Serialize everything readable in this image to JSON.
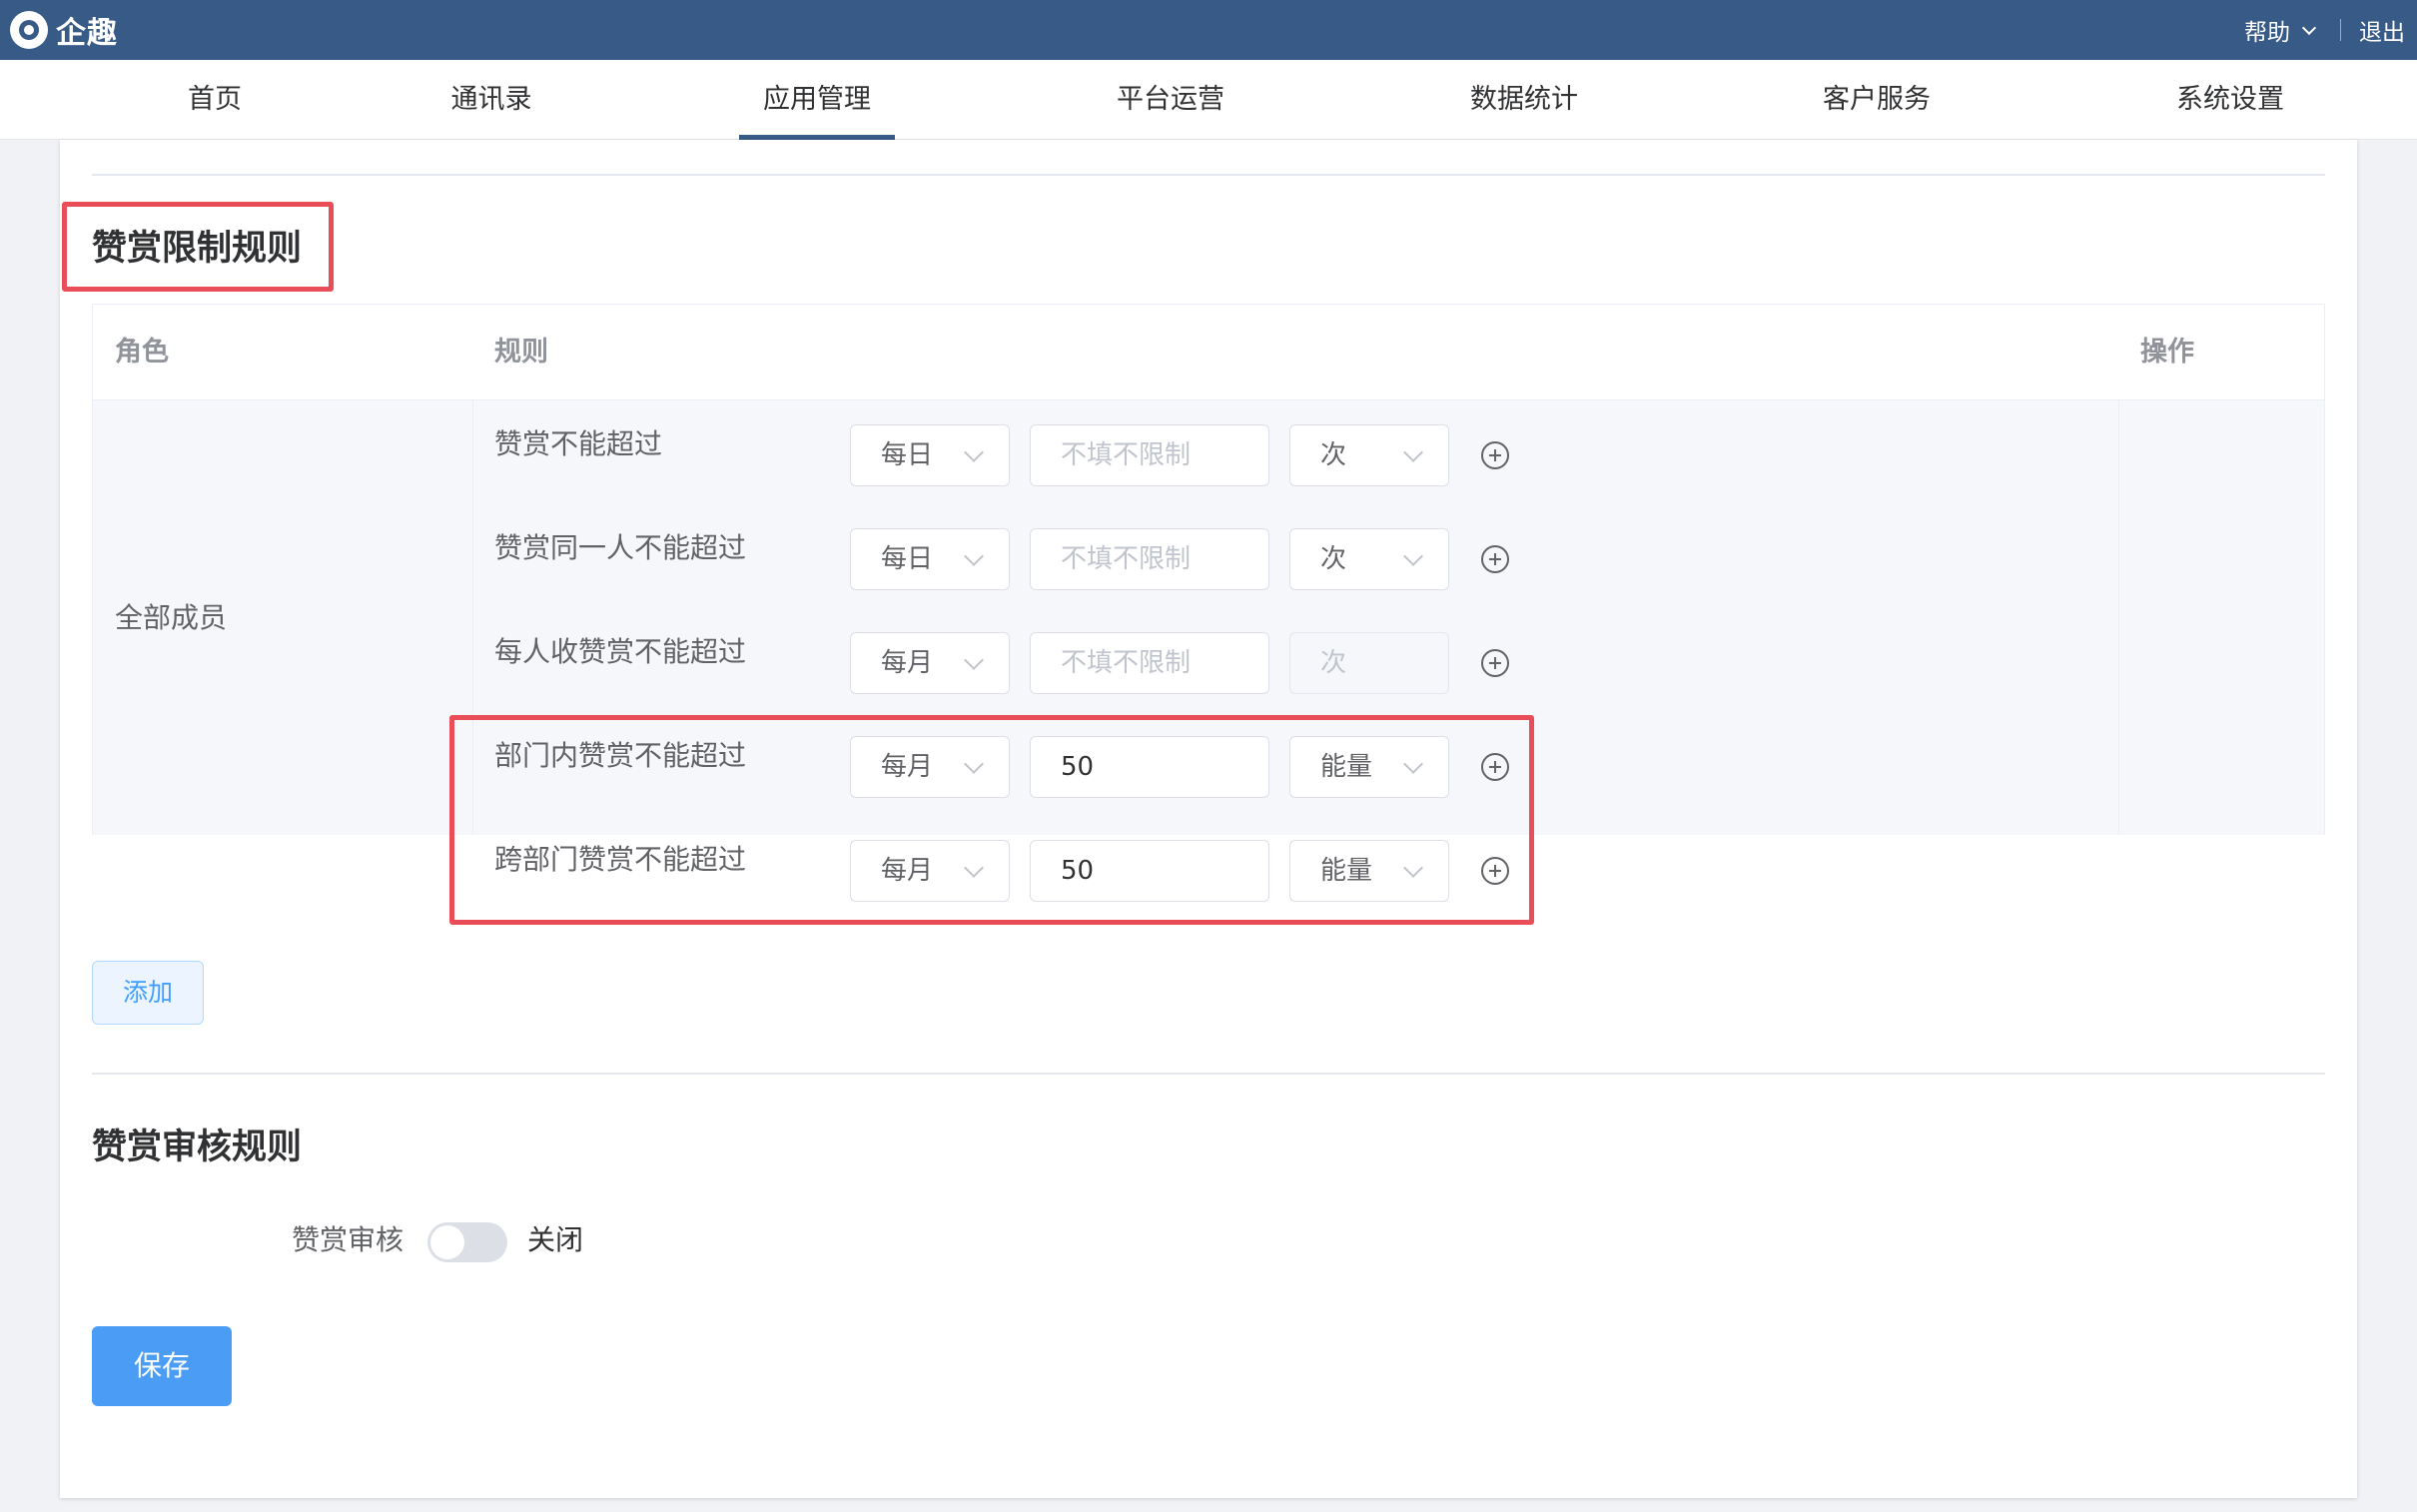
{
  "app": {
    "name": "企趣"
  },
  "top_right": {
    "help_label": "帮助",
    "logout_label": "退出"
  },
  "nav": {
    "items": [
      {
        "label": "首页"
      },
      {
        "label": "通讯录"
      },
      {
        "label": "应用管理",
        "active": true
      },
      {
        "label": "平台运营"
      },
      {
        "label": "数据统计"
      },
      {
        "label": "客户服务"
      },
      {
        "label": "系统设置"
      }
    ]
  },
  "limit_section": {
    "title": "赞赏限制规则",
    "columns": {
      "role": "角色",
      "rule": "规则",
      "action": "操作"
    },
    "role": "全部成员",
    "rules": [
      {
        "label": "赞赏不能超过",
        "period": "每日",
        "value": "",
        "placeholder": "不填不限制",
        "unit": "次",
        "unit_disabled": false
      },
      {
        "label": "赞赏同一人不能超过",
        "period": "每日",
        "value": "",
        "placeholder": "不填不限制",
        "unit": "次",
        "unit_disabled": false
      },
      {
        "label": "每人收赞赏不能超过",
        "period": "每月",
        "value": "",
        "placeholder": "不填不限制",
        "unit": "次",
        "unit_disabled": true
      },
      {
        "label": "部门内赞赏不能超过",
        "period": "每月",
        "value": "50",
        "placeholder": "",
        "unit": "能量",
        "unit_disabled": false
      },
      {
        "label": "跨部门赞赏不能超过",
        "period": "每月",
        "value": "50",
        "placeholder": "",
        "unit": "能量",
        "unit_disabled": false
      }
    ],
    "add_button": "添加"
  },
  "audit_section": {
    "title": "赞赏审核规则",
    "toggle_label": "赞赏审核",
    "toggle_state": "关闭",
    "toggle_on": false
  },
  "save_button": "保存",
  "colors": {
    "topbar": "#375a86",
    "primary": "#4a9cf5",
    "highlight": "#e94d57"
  }
}
